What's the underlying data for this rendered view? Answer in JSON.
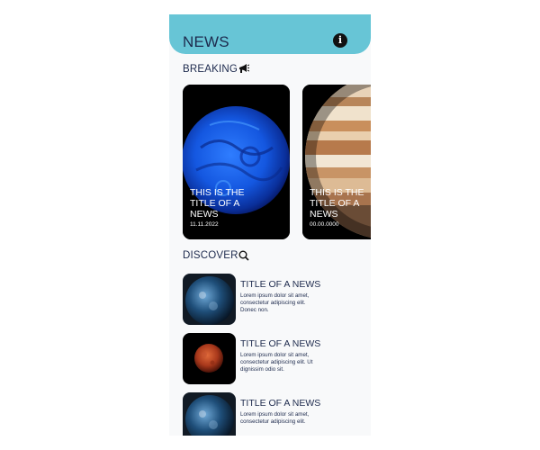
{
  "header": {
    "title": "NEWS",
    "info_icon": "info-icon"
  },
  "breaking": {
    "label": "BREAKING",
    "icon": "megaphone-icon",
    "cards": [
      {
        "title": "THIS IS THE TITLE OF A NEWS",
        "date": "11.11.2022",
        "image": "blue-planet"
      },
      {
        "title": "THIS IS THE TITLE OF A NEWS",
        "date": "00.00.0000",
        "image": "jupiter"
      }
    ]
  },
  "discover": {
    "label": "DISCOVER",
    "icon": "search-icon",
    "items": [
      {
        "title": "TITLE OF A NEWS",
        "desc": "Lorem ipsum dolor sit amet, consectetur adipiscing elit. Donec non.",
        "image": "earth-night"
      },
      {
        "title": "TITLE OF A NEWS",
        "desc": "Lorem ipsum dolor sit amet, consectetur adipiscing elit. Ut dignissim odio sit.",
        "image": "blood-moon"
      },
      {
        "title": "TITLE OF A NEWS",
        "desc": "Lorem ipsum dolor sit amet, consectetur adipiscing elit.",
        "image": "earth-night"
      }
    ]
  },
  "colors": {
    "header": "#67c5d6",
    "text": "#1d2a4d",
    "background": "#f8f9fa"
  }
}
